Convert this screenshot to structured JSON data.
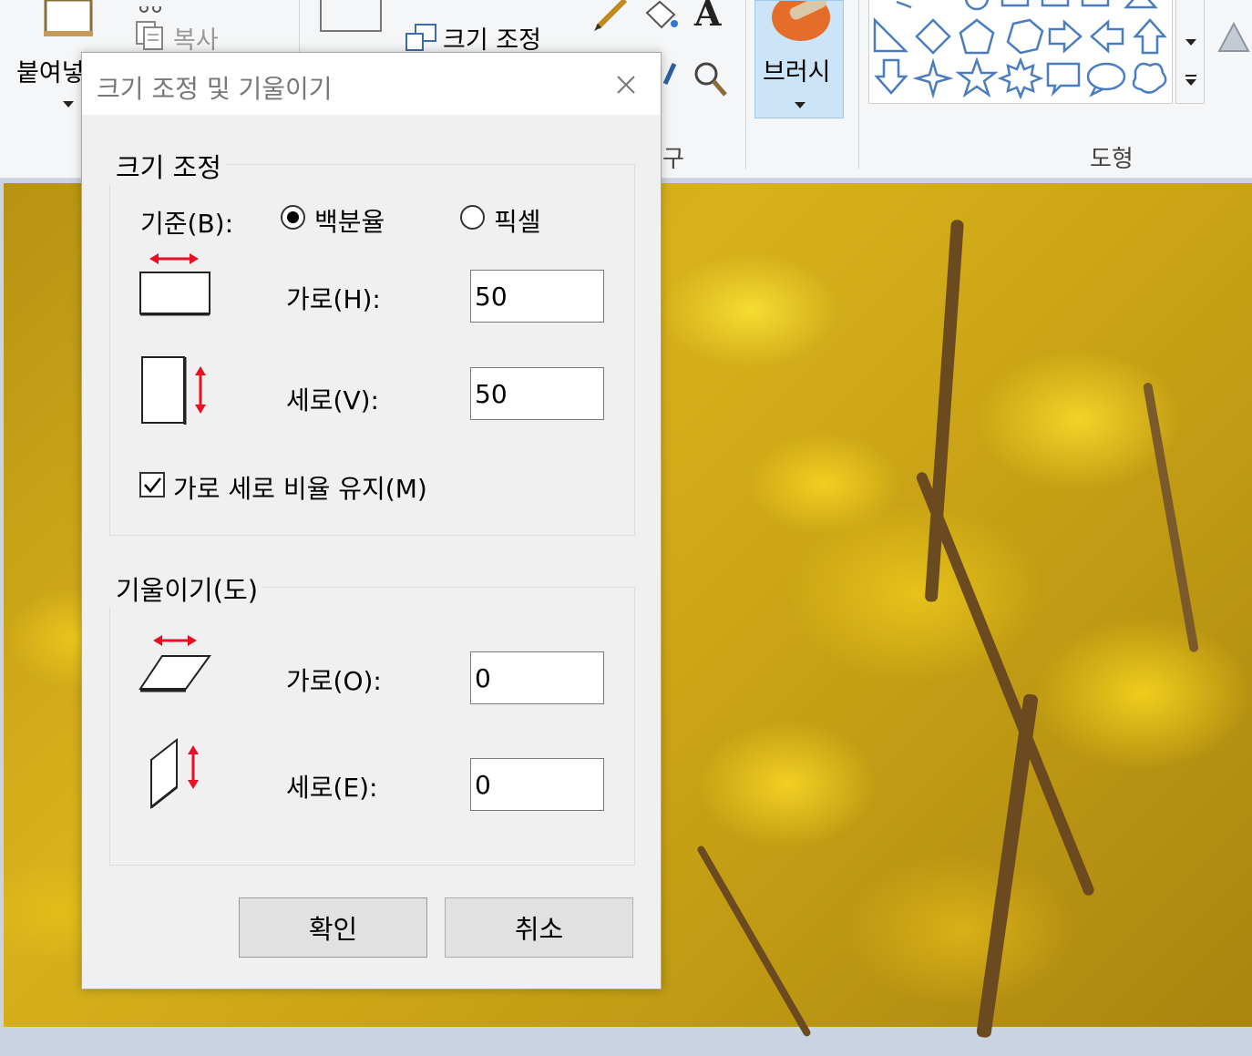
{
  "ribbon": {
    "paste_label": "붙여넣",
    "copy_label": "복사",
    "resize_label": "크기 조정",
    "brush_label": "브러시",
    "tools_label_fragment": "구",
    "shapes_label": "도형"
  },
  "dialog": {
    "title": "크기 조정 및 기울이기",
    "resize": {
      "group_label": "크기 조정",
      "basis_label": "기준(B):",
      "percent_label": "백분율",
      "pixel_label": "픽셀",
      "selected_basis": "percent",
      "horizontal_label": "가로(H):",
      "horizontal_value": "50",
      "vertical_label": "세로(V):",
      "vertical_value": "50",
      "keep_ratio_label": "가로 세로 비율 유지(M)",
      "keep_ratio_checked": true
    },
    "skew": {
      "group_label": "기울이기(도)",
      "horizontal_label": "가로(O):",
      "horizontal_value": "0",
      "vertical_label": "세로(E):",
      "vertical_value": "0"
    },
    "ok_label": "확인",
    "cancel_label": "취소"
  },
  "colors": {
    "arrow_red": "#e81123",
    "brush_highlight": "#cce4f7",
    "canvas_bg": "#c9d3e2"
  }
}
